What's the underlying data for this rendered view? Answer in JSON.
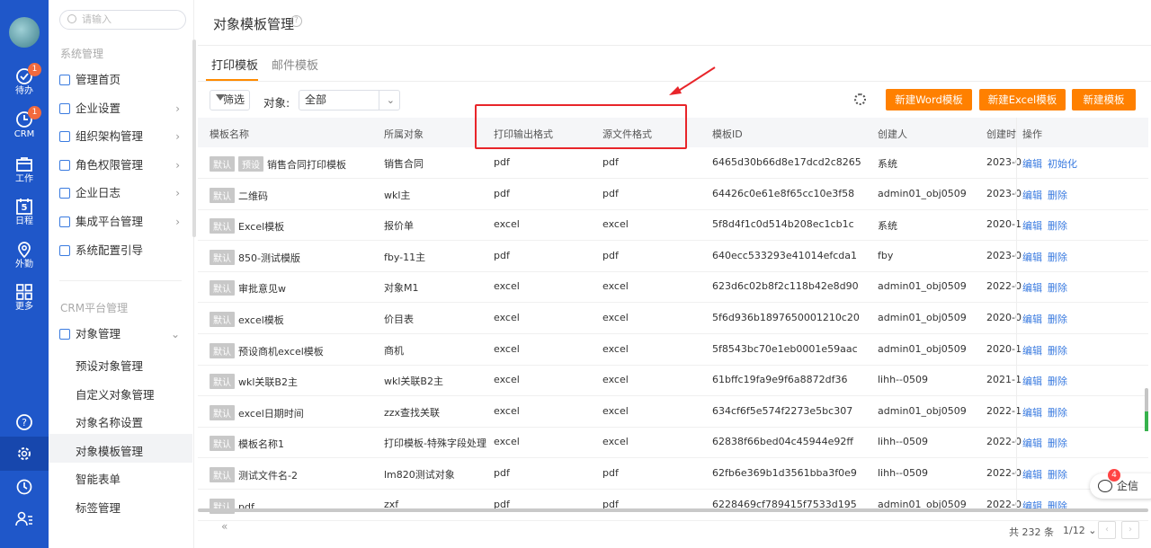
{
  "rail": {
    "items": [
      {
        "label": "待办",
        "icon": "check-circle-icon",
        "badge": "1"
      },
      {
        "label": "CRM",
        "icon": "clock-icon",
        "badge": "1"
      },
      {
        "label": "工作",
        "icon": "briefcase-icon"
      },
      {
        "label": "日程",
        "icon": "calendar-icon",
        "day": "5"
      },
      {
        "label": "外勤",
        "icon": "location-pin-icon"
      },
      {
        "label": "更多",
        "icon": "grid-icon"
      }
    ],
    "bottom_icons": [
      "help-icon",
      "settings-icon",
      "history-icon",
      "user-list-icon"
    ]
  },
  "nav": {
    "search_placeholder": "请输入",
    "section_system": "系统管理",
    "system_items": [
      {
        "label": "管理首页",
        "chevron": ""
      },
      {
        "label": "企业设置",
        "chevron": "›"
      },
      {
        "label": "组织架构管理",
        "chevron": "›"
      },
      {
        "label": "角色权限管理",
        "chevron": "›"
      },
      {
        "label": "企业日志",
        "chevron": "›"
      },
      {
        "label": "集成平台管理",
        "chevron": "›"
      },
      {
        "label": "系统配置引导",
        "chevron": ""
      }
    ],
    "section_crm": "CRM平台管理",
    "crm_parent": "对象管理",
    "crm_parent_chevron": "⌄",
    "crm_children": [
      "预设对象管理",
      "自定义对象管理",
      "对象名称设置",
      "对象模板管理",
      "智能表单",
      "标签管理"
    ],
    "collapse": "«"
  },
  "page": {
    "title": "对象模板管理",
    "help": "?",
    "tabs": [
      "打印模板",
      "邮件模板"
    ],
    "filter_label": "筛选",
    "object_label": "对象:",
    "object_value": "全部",
    "dropdown_arrow": "⌄",
    "buttons": [
      "新建Word模板",
      "新建Excel模板",
      "新建模板"
    ]
  },
  "table": {
    "columns": [
      "模板名称",
      "所属对象",
      "打印输出格式",
      "源文件格式",
      "模板ID",
      "创建人",
      "创建时",
      "操作"
    ],
    "rows": [
      {
        "tags": [
          "默认",
          "预设"
        ],
        "name": "销售合同打印模板",
        "object": "销售合同",
        "out": "pdf",
        "src": "pdf",
        "id": "6465d30b66d8e17dcd2c8265",
        "creator": "系统",
        "created": "2023-0",
        "ops": [
          "编辑",
          "初始化"
        ]
      },
      {
        "tags": [
          "默认"
        ],
        "name": "二维码",
        "object": "wkl主",
        "out": "pdf",
        "src": "pdf",
        "id": "64426c0e61e8f65cc10e3f58",
        "creator": "admin01_obj0509",
        "created": "2023-0",
        "ops": [
          "编辑",
          "删除"
        ]
      },
      {
        "tags": [
          "默认"
        ],
        "name": "Excel模板",
        "object": "报价单",
        "out": "excel",
        "src": "excel",
        "id": "5f8d4f1c0d514b208ec1cb1c",
        "creator": "系统",
        "created": "2020-1",
        "ops": [
          "编辑",
          "删除"
        ]
      },
      {
        "tags": [
          "默认"
        ],
        "name": "850-测试模版",
        "object": "fby-11主",
        "out": "pdf",
        "src": "pdf",
        "id": "640ecc533293e41014efcda1",
        "creator": "fby",
        "created": "2023-0",
        "ops": [
          "编辑",
          "删除"
        ]
      },
      {
        "tags": [
          "默认"
        ],
        "name": "审批意见w",
        "object": "对象M1",
        "out": "excel",
        "src": "excel",
        "id": "623d6c02b8f2c118b42e8d90",
        "creator": "admin01_obj0509",
        "created": "2022-0",
        "ops": [
          "编辑",
          "删除"
        ]
      },
      {
        "tags": [
          "默认"
        ],
        "name": "excel模板",
        "object": "价目表",
        "out": "excel",
        "src": "excel",
        "id": "5f6d936b1897650001210c20",
        "creator": "admin01_obj0509",
        "created": "2020-0",
        "ops": [
          "编辑",
          "删除"
        ]
      },
      {
        "tags": [
          "默认"
        ],
        "name": "预设商机excel模板",
        "object": "商机",
        "out": "excel",
        "src": "excel",
        "id": "5f8543bc70e1eb0001e59aac",
        "creator": "admin01_obj0509",
        "created": "2020-1",
        "ops": [
          "编辑",
          "删除"
        ]
      },
      {
        "tags": [
          "默认"
        ],
        "name": "wkl关联B2主",
        "object": "wkl关联B2主",
        "out": "excel",
        "src": "excel",
        "id": "61bffc19fa9e9f6a8872df36",
        "creator": "lihh--0509",
        "created": "2021-1",
        "ops": [
          "编辑",
          "删除"
        ]
      },
      {
        "tags": [
          "默认"
        ],
        "name": "excel日期时间",
        "object": "zzx查找关联",
        "out": "excel",
        "src": "excel",
        "id": "634cf6f5e574f2273e5bc307",
        "creator": "admin01_obj0509",
        "created": "2022-1",
        "ops": [
          "编辑",
          "删除"
        ]
      },
      {
        "tags": [
          "默认"
        ],
        "name": "模板名称1",
        "object": "打印模板-特殊字段处理",
        "out": "excel",
        "src": "excel",
        "id": "62838f66bed04c45944e92ff",
        "creator": "lihh--0509",
        "created": "2022-0",
        "ops": [
          "编辑",
          "删除"
        ]
      },
      {
        "tags": [
          "默认"
        ],
        "name": "测试文件名-2",
        "object": "lm820测试对象",
        "out": "pdf",
        "src": "pdf",
        "id": "62fb6e369b1d3561bba3f0e9",
        "creator": "lihh--0509",
        "created": "2022-0",
        "ops": [
          "编辑",
          "删除"
        ]
      },
      {
        "tags": [
          "默认"
        ],
        "name": "pdf",
        "object": "zxf",
        "out": "pdf",
        "src": "pdf",
        "id": "6228469cf789415f7533d195",
        "creator": "admin01_obj0509",
        "created": "2022-0",
        "ops": [
          "编辑",
          "删除"
        ]
      }
    ]
  },
  "footer": {
    "total": "共 232 条",
    "page": "1/12",
    "page_arrow": "⌄",
    "prev": "‹",
    "next": "›"
  },
  "qixin": {
    "label": "企信",
    "badge": "4"
  },
  "colors": {
    "rail": "#1f57c9",
    "accent": "#ff8000",
    "link": "#3a7be0",
    "highlight": "#e8252a"
  }
}
